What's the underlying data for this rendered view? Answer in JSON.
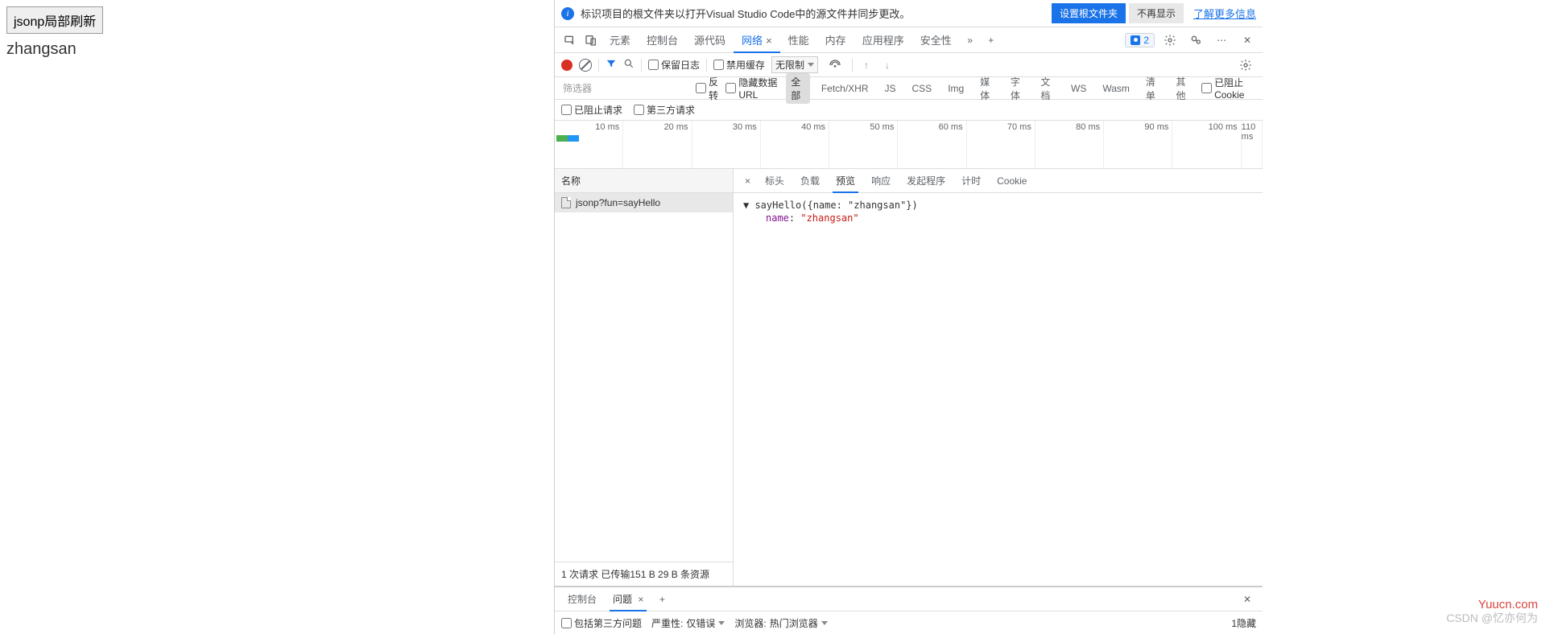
{
  "page": {
    "button_label": "jsonp局部刷新",
    "result_text": "zhangsan"
  },
  "infobar": {
    "text": "标识项目的根文件夹以打开Visual Studio Code中的源文件并同步更改。",
    "primary_btn": "设置根文件夹",
    "secondary_btn": "不再显示",
    "link": "了解更多信息"
  },
  "main_tabs": {
    "items": [
      "元素",
      "控制台",
      "源代码",
      "网络",
      "性能",
      "内存",
      "应用程序",
      "安全性"
    ],
    "active_index": 3,
    "issue_count": "2"
  },
  "net_toolbar": {
    "preserve_log": "保留日志",
    "disable_cache": "禁用缓存",
    "throttle": "无限制"
  },
  "filter_row": {
    "placeholder": "筛选器",
    "invert": "反转",
    "hide_data_urls": "隐藏数据 URL",
    "types": [
      "全部",
      "Fetch/XHR",
      "JS",
      "CSS",
      "Img",
      "媒体",
      "字体",
      "文档",
      "WS",
      "Wasm",
      "清单",
      "其他"
    ],
    "blocked_cookies": "已阻止 Cookie"
  },
  "filter_row2": {
    "blocked_requests": "已阻止请求",
    "third_party": "第三方请求"
  },
  "timeline": {
    "labels": [
      "10 ms",
      "20 ms",
      "30 ms",
      "40 ms",
      "50 ms",
      "60 ms",
      "70 ms",
      "80 ms",
      "90 ms",
      "100 ms",
      "110 ms"
    ]
  },
  "requests": {
    "header": "名称",
    "items": [
      "jsonp?fun=sayHello"
    ],
    "footer": "1 次请求  已传输151 B  29 B 条资源"
  },
  "detail_tabs": {
    "items": [
      "标头",
      "负载",
      "预览",
      "响应",
      "发起程序",
      "计时",
      "Cookie"
    ],
    "active_index": 2
  },
  "preview": {
    "line1": "sayHello({name: \"zhangsan\"})",
    "key": "name",
    "value": "\"zhangsan\""
  },
  "drawer": {
    "tabs": [
      "控制台",
      "问题"
    ],
    "active_index": 1,
    "include_third_party": "包括第三方问题",
    "severity_label": "严重性:",
    "severity_value": "仅错误",
    "browser_label": "浏览器:",
    "browser_value": "热门浏览器",
    "hidden": "1隐藏"
  },
  "watermark": {
    "w1": "Yuucn.com",
    "w2": "CSDN @忆亦何为"
  }
}
